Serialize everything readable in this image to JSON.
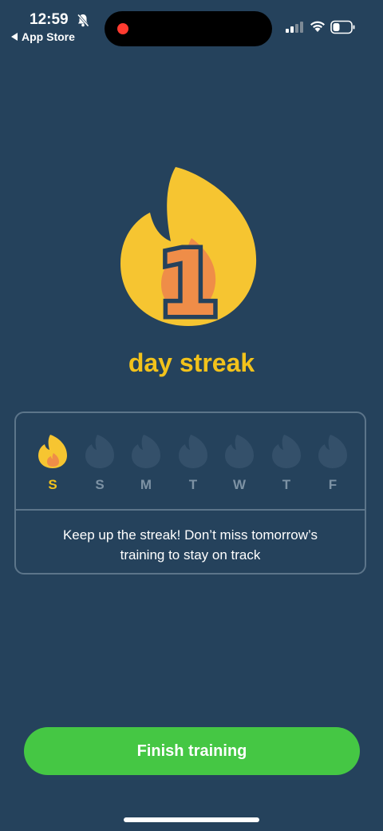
{
  "status_bar": {
    "time": "12:59",
    "back_app": "App Store",
    "icons": [
      "bell-slash-icon",
      "signal-icon",
      "wifi-icon",
      "battery-icon"
    ],
    "record_color": "#ff3b30"
  },
  "streak": {
    "count": "1",
    "label": "day streak",
    "accent_color": "#f2c21b"
  },
  "week": {
    "days": [
      {
        "label": "S",
        "active": true
      },
      {
        "label": "S",
        "active": false
      },
      {
        "label": "M",
        "active": false
      },
      {
        "label": "T",
        "active": false
      },
      {
        "label": "W",
        "active": false
      },
      {
        "label": "T",
        "active": false
      },
      {
        "label": "F",
        "active": false
      }
    ],
    "message_line1": "Keep up the streak! Don’t miss tomorrow’s",
    "message_line2": "training to stay on track"
  },
  "actions": {
    "finish_label": "Finish training",
    "finish_color": "#45c744"
  },
  "theme": {
    "background": "#25425c",
    "inactive_flame": "#34506a",
    "card_border": "#5c758a"
  }
}
